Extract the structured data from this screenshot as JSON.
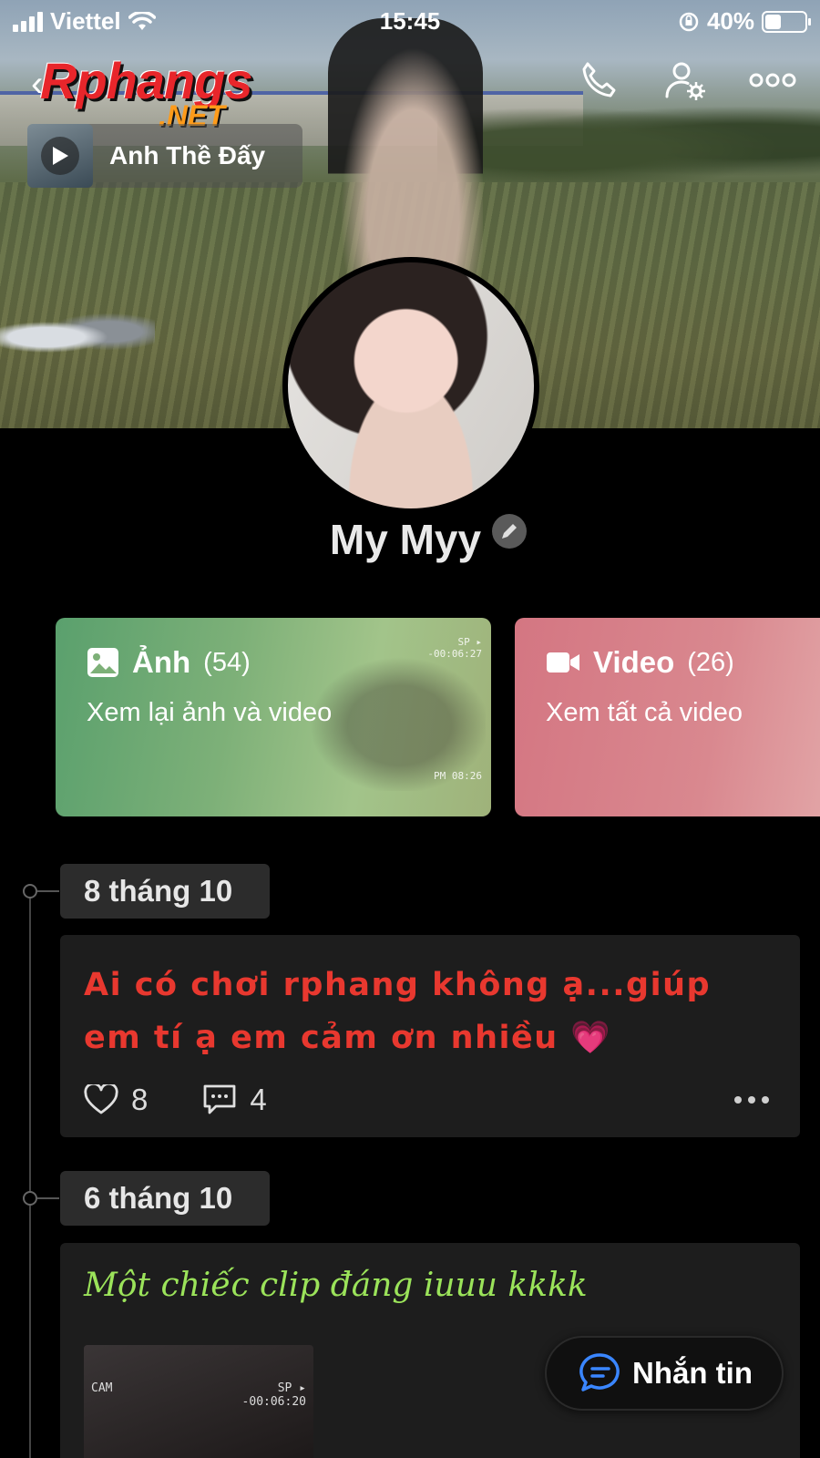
{
  "status_bar": {
    "carrier": "Viettel",
    "time": "15:45",
    "battery": "40%",
    "battery_level": 0.4
  },
  "logo": {
    "word": "Rphangs",
    "suffix": ".NET"
  },
  "music": {
    "title": "Anh Thề Đấy"
  },
  "profile": {
    "name": "My Myy"
  },
  "media_cards": {
    "photos": {
      "label": "Ảnh",
      "count": "(54)",
      "subtitle": "Xem lại ảnh và video",
      "vhs_top": "SP ▸\n-00:06:27",
      "vhs_bottom": "PM 08:26"
    },
    "videos": {
      "label": "Video",
      "count": "(26)",
      "subtitle": "Xem tất cả video"
    }
  },
  "timeline": {
    "groups": [
      {
        "date": "8 tháng 10"
      },
      {
        "date": "6 tháng 10"
      }
    ],
    "post1": {
      "text": "Ai có chơi rphang không ạ...giúp em tí ạ em cảm ơn nhiều 💗",
      "likes": "8",
      "comments": "4"
    },
    "post2": {
      "text": "Một chiếc clip đáng iuuu kkkk",
      "clip_cam": "CAM",
      "clip_sp": "SP ▸",
      "clip_time": "-00:06:20"
    }
  },
  "message_button": {
    "label": "Nhắn tin"
  },
  "colors": {
    "post1_text": "#e8382f",
    "post2_text": "#9be35a",
    "photos_card": "#7db078",
    "videos_card": "#d9888f"
  }
}
